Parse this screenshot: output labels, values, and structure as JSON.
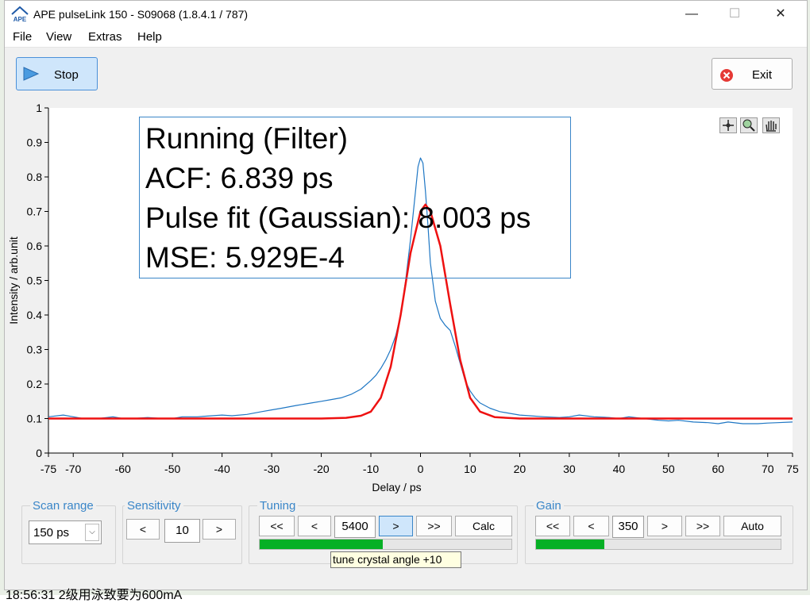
{
  "window": {
    "title": "APE pulseLink 150 - S09068 (1.8.4.1 / 787)",
    "logo_text": "APE",
    "minimize_glyph": "—",
    "maximize_glyph": "☐",
    "close_glyph": "✕"
  },
  "menu": [
    "File",
    "View",
    "Extras",
    "Help"
  ],
  "toolbar": {
    "stop_label": "Stop",
    "exit_label": "Exit"
  },
  "overlay": {
    "status": "Running (Filter)",
    "acf": "ACF: 6.839 ps",
    "fit": "Pulse fit (Gaussian): 8.003 ps",
    "mse": "MSE: 5.929E-4"
  },
  "plot_tools": [
    "crosshair-icon",
    "zoom-icon",
    "pan-hand-icon"
  ],
  "chart_data": {
    "type": "line",
    "xlabel": "Delay / ps",
    "ylabel": "Intensity / arb.unit",
    "xlim": [
      -75,
      75
    ],
    "ylim": [
      0,
      1
    ],
    "xticks": [
      -75,
      -70,
      -60,
      -50,
      -40,
      -30,
      -20,
      -10,
      0,
      10,
      20,
      30,
      40,
      50,
      60,
      70,
      75
    ],
    "yticks": [
      0,
      0.1,
      0.2,
      0.3,
      0.4,
      0.5,
      0.6,
      0.7,
      0.8,
      0.9,
      1
    ],
    "grid": false,
    "legend": false,
    "series": [
      {
        "color": "#1f77c4",
        "x": [
          -75,
          -72,
          -70,
          -68,
          -65,
          -62,
          -60,
          -58,
          -55,
          -52,
          -50,
          -48,
          -45,
          -42,
          -40,
          -38,
          -35,
          -32,
          -30,
          -28,
          -25,
          -22,
          -20,
          -18,
          -16,
          -14,
          -12,
          -10,
          -9,
          -8,
          -7,
          -6,
          -5,
          -4,
          -3,
          -2,
          -1,
          -0.5,
          0,
          0.5,
          1,
          1.5,
          2,
          3,
          4,
          5,
          6,
          7,
          8,
          9,
          10,
          11,
          12,
          14,
          16,
          18,
          20,
          22,
          25,
          28,
          30,
          32,
          35,
          38,
          40,
          42,
          45,
          48,
          50,
          52,
          55,
          58,
          60,
          62,
          65,
          68,
          70,
          72,
          75
        ],
        "values": [
          0.105,
          0.11,
          0.105,
          0.1,
          0.1,
          0.105,
          0.1,
          0.1,
          0.103,
          0.1,
          0.1,
          0.105,
          0.105,
          0.108,
          0.11,
          0.108,
          0.112,
          0.12,
          0.125,
          0.13,
          0.138,
          0.145,
          0.15,
          0.155,
          0.16,
          0.17,
          0.185,
          0.21,
          0.225,
          0.245,
          0.27,
          0.3,
          0.34,
          0.4,
          0.5,
          0.62,
          0.76,
          0.83,
          0.855,
          0.84,
          0.76,
          0.66,
          0.55,
          0.44,
          0.39,
          0.37,
          0.355,
          0.31,
          0.26,
          0.21,
          0.18,
          0.16,
          0.145,
          0.13,
          0.12,
          0.115,
          0.11,
          0.108,
          0.105,
          0.103,
          0.105,
          0.11,
          0.105,
          0.103,
          0.1,
          0.105,
          0.1,
          0.095,
          0.093,
          0.095,
          0.09,
          0.088,
          0.085,
          0.09,
          0.085,
          0.085,
          0.087,
          0.088,
          0.09
        ]
      },
      {
        "color": "#ee1111",
        "x": [
          -75,
          -40,
          -20,
          -15,
          -12,
          -10,
          -8,
          -6,
          -4,
          -2,
          0,
          1,
          2,
          4,
          6,
          8,
          10,
          12,
          15,
          20,
          40,
          75
        ],
        "values": [
          0.1,
          0.1,
          0.1,
          0.102,
          0.108,
          0.12,
          0.16,
          0.25,
          0.4,
          0.58,
          0.7,
          0.72,
          0.7,
          0.6,
          0.43,
          0.27,
          0.16,
          0.12,
          0.104,
          0.1,
          0.1,
          0.1
        ]
      }
    ]
  },
  "controls": {
    "scan_range": {
      "label": "Scan range",
      "value": "150 ps"
    },
    "sensitivity": {
      "label": "Sensitivity",
      "prev": "<",
      "value": "10",
      "next": ">"
    },
    "tuning": {
      "label": "Tuning",
      "fast_prev": "<<",
      "prev": "<",
      "value": "5400",
      "next": ">",
      "fast_next": ">>",
      "calc": "Calc",
      "progress": 0.49
    },
    "gain": {
      "label": "Gain",
      "fast_prev": "<<",
      "prev": "<",
      "value": "350",
      "next": ">",
      "fast_next": ">>",
      "auto": "Auto",
      "progress": 0.28
    }
  },
  "tooltip": "tune crystal angle +10",
  "background_text": "18:56:31 2级用泳致要为600mA"
}
